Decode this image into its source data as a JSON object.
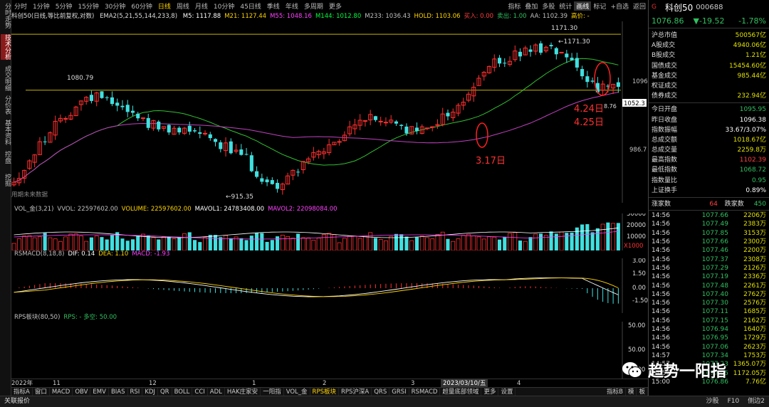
{
  "left_tabs": [
    {
      "label": "分时走势",
      "active": false
    },
    {
      "label": "技术分析",
      "active": true
    },
    {
      "label": "成交明细",
      "active": false
    },
    {
      "label": "分价表",
      "active": false
    },
    {
      "label": "基本资料",
      "active": false
    },
    {
      "label": "控盘",
      "active": false
    },
    {
      "label": "挖掘",
      "active": false
    }
  ],
  "period_tabs": [
    "分时",
    "1分钟",
    "5分钟",
    "15分钟",
    "30分钟",
    "60分钟",
    "日线",
    "周线",
    "月线",
    "10分钟",
    "45日线",
    "季线",
    "年线",
    "多周期",
    "更多"
  ],
  "period_active": "日线",
  "toolbar_right": [
    "指标",
    "叠加",
    "多股",
    "统计",
    "画线",
    "标记",
    "+自选",
    "返回"
  ],
  "indicator_line": {
    "name": "科创50(日线,等比前复权,对数)",
    "ema_label": "EMA2(5,21,55,144,233,8)",
    "items": [
      {
        "text": "M5: 1117.88",
        "color": "#ffffff"
      },
      {
        "text": "M21: 1127.44",
        "color": "#ffd400"
      },
      {
        "text": "M55: 1048.16",
        "color": "#ff40ff"
      },
      {
        "text": "M144: 1012.80",
        "color": "#00ff40"
      },
      {
        "text": "M233: 1036.43",
        "color": "#c0c0c0"
      },
      {
        "text": "HOLD: 1103.06",
        "color": "#ffd400"
      },
      {
        "text": "买入: 0.00",
        "color": "#ff4040"
      },
      {
        "text": "卖出: 1.00",
        "color": "#30c060"
      },
      {
        "text": "AA: 1102.39",
        "color": "#c0c0c0"
      },
      {
        "text": "高价: -",
        "color": "#ffd400"
      }
    ]
  },
  "main_chart": {
    "price_high_label": "1171.30",
    "high_marker": "1171.30",
    "mid_label": "1080.79",
    "low_label": "915.35",
    "right_level_1096": "1096",
    "right_level_1052": "1052.3",
    "right_level_986": "986.7",
    "last_low_label": "8.76",
    "watermark": "用期未来数据",
    "annotation_317": "3.17日",
    "annotation_424": "4.24日",
    "annotation_425": "4.25日"
  },
  "vol_panel": {
    "items": [
      {
        "text": "VOL_金(3,21)",
        "color": "#c0c0c0"
      },
      {
        "text": "VVOL: 22597602.00",
        "color": "#c0c0c0"
      },
      {
        "text": "VOLUME: 22597602.00",
        "color": "#ffd400"
      },
      {
        "text": "MAVOL1: 24783408.00",
        "color": "#ffffff"
      },
      {
        "text": "MAVOL2: 22098084.00",
        "color": "#ff40ff"
      }
    ],
    "y_labels": [
      "30000",
      "20000",
      "10000"
    ],
    "unit": "X1000"
  },
  "macd_panel": {
    "items": [
      {
        "text": "RSMACD(8,18,8)",
        "color": "#c0c0c0"
      },
      {
        "text": "DIF: 0.14",
        "color": "#ffffff"
      },
      {
        "text": "DEA: 1.10",
        "color": "#ffd400"
      },
      {
        "text": "MACD: -1.93",
        "color": "#ff40ff"
      }
    ],
    "y_labels": [
      "3.00",
      "1.50",
      "0.00",
      "-1.50"
    ]
  },
  "rps_panel": {
    "items": [
      {
        "text": "RPS板块(80,50)",
        "color": "#c0c0c0"
      },
      {
        "text": "RPS: - 多空: 50.00",
        "color": "#30c060"
      }
    ],
    "y_labels": [
      "50.00",
      "50.00",
      "50.00"
    ]
  },
  "x_axis": {
    "labels": [
      {
        "text": "2022年",
        "pos": 0.0
      },
      {
        "text": "11",
        "pos": 0.068
      },
      {
        "text": "12",
        "pos": 0.225
      },
      {
        "text": "1",
        "pos": 0.395
      },
      {
        "text": "2",
        "pos": 0.51
      },
      {
        "text": "3",
        "pos": 0.655
      },
      {
        "text": "2023/03/10/五",
        "pos": 0.705
      },
      {
        "text": "4",
        "pos": 0.83
      }
    ]
  },
  "bottom_tabs": [
    "指标A",
    "窗口",
    "MACD",
    "OBV",
    "EMV",
    "BIAS",
    "RSI",
    "KDJ",
    "QR",
    "BOLL",
    "CCI",
    "ADL",
    "HAK庄家安",
    "一阳指",
    "VOL_金",
    "RPS板块",
    "RPS沪深A",
    "QRS",
    "GRSI",
    "RSMACD",
    "超量底部领域",
    "更多",
    "设置"
  ],
  "bottom_active": "RPS板块",
  "bottom_right": [
    "指标B",
    "模",
    "板"
  ],
  "status_bar": {
    "left": "关联报价",
    "mid": "沙股",
    "right1": "F10",
    "right2": "侧边2"
  },
  "quote": {
    "g": "G",
    "name": "科创50",
    "code": "000688",
    "price": "1076.86",
    "change": "▼-19.52",
    "pct": "-1.78%",
    "rows_top": [
      {
        "k": "沪总市值",
        "v": "500567亿",
        "c": "#e0e000"
      },
      {
        "k": "A股成交",
        "v": "4940.06亿",
        "c": "#e0e000"
      },
      {
        "k": "B股成交",
        "v": "1.21亿",
        "c": "#e0e000"
      },
      {
        "k": "国债成交",
        "v": "15454.60亿",
        "c": "#e0e000"
      },
      {
        "k": "基金成交",
        "v": "985.44亿",
        "c": "#e0e000"
      },
      {
        "k": "权证成交",
        "v": "",
        "c": "#e0e000"
      },
      {
        "k": "债券成交",
        "v": "232.94亿",
        "c": "#e0e000"
      }
    ],
    "rows_mid": [
      {
        "k": "今日开盘",
        "v": "1095.95",
        "c": "#30c060"
      },
      {
        "k": "昨日收盘",
        "v": "1096.38",
        "c": "#ffffff"
      },
      {
        "k": "指数振幅",
        "v": "33.67/3.07%",
        "c": "#ffffff"
      },
      {
        "k": "总成交额",
        "v": "1018.67亿",
        "c": "#e0e000"
      },
      {
        "k": "总成交量",
        "v": "2259.8万",
        "c": "#e0e000"
      },
      {
        "k": "最高指数",
        "v": "1102.39",
        "c": "#ff4040"
      },
      {
        "k": "最低指数",
        "v": "1068.72",
        "c": "#30c060"
      },
      {
        "k": "指数量比",
        "v": "0.95",
        "c": "#30c060"
      },
      {
        "k": "上证换手",
        "v": "0.89%",
        "c": "#ffffff"
      }
    ],
    "updown": {
      "up_label": "涨家数",
      "up": "64",
      "down_label": "跌家数",
      "down": "450"
    },
    "ticks": [
      [
        "14:56",
        "1077.66",
        "2206万"
      ],
      [
        "14:56",
        "1077.49",
        "2383万"
      ],
      [
        "14:56",
        "1077.85",
        "3153万"
      ],
      [
        "14:56",
        "1077.66",
        "2300万"
      ],
      [
        "14:56",
        "1077.46",
        "2200万"
      ],
      [
        "14:56",
        "1077.37",
        "2308万"
      ],
      [
        "14:56",
        "1077.29",
        "2126万"
      ],
      [
        "14:56",
        "1077.19",
        "2336万"
      ],
      [
        "14:56",
        "1077.48",
        "2261万"
      ],
      [
        "14:56",
        "1077.40",
        "2762万"
      ],
      [
        "14:56",
        "1077.30",
        "2576万"
      ],
      [
        "14:56",
        "1077.11",
        "1685万"
      ],
      [
        "14:56",
        "1077.15",
        "2162万"
      ],
      [
        "14:56",
        "1076.94",
        "1640万"
      ],
      [
        "14:56",
        "1076.95",
        "1729万"
      ],
      [
        "14:56",
        "1077.06",
        "2623万"
      ],
      [
        "14:57",
        "1077.34",
        "1753万"
      ],
      [
        "14:57",
        "1077.23",
        "1365.07万"
      ],
      [
        "14:57",
        "1077.05",
        "1172.05万"
      ],
      [
        "15:00",
        "1076.86",
        "7.76亿"
      ]
    ]
  },
  "watermark_text": "趋势一阳指"
}
